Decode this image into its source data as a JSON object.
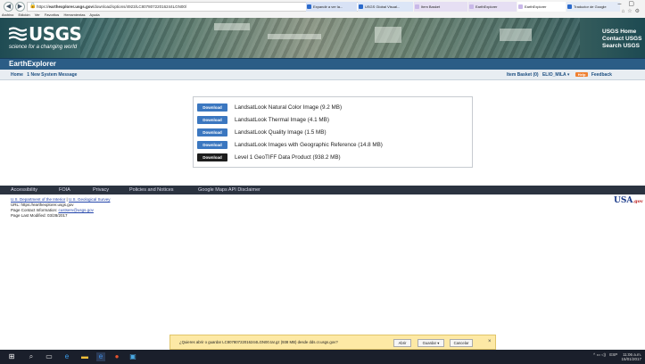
{
  "browser": {
    "url_host": "earthexplorer.usgs.gov",
    "url_prefix": "https://",
    "url_path": "/download/options/4923/LC80780722016244LGN00/",
    "tabs": [
      {
        "label": "Expandir a ver la...",
        "color": "#2b6acb"
      },
      {
        "label": "USGS Global Visual...",
        "color": "#2b6acb"
      },
      {
        "label": "Item Basket",
        "color": "#e8e0f6"
      },
      {
        "label": "EarthExplorer",
        "color": "#e8e0f6"
      },
      {
        "label": "EarthExplorer",
        "color": "#e8e0f6"
      },
      {
        "label": "Traductor de Google",
        "color": "#2b6acb"
      }
    ],
    "menu": [
      "Archivo",
      "Edición",
      "Ver",
      "Favoritos",
      "Herramientas",
      "Ayuda"
    ]
  },
  "header": {
    "logo_word": "USGS",
    "logo_tagline": "science for a changing world",
    "links": [
      "USGS Home",
      "Contact USGS",
      "Search USGS"
    ]
  },
  "app_title": "EarthExplorer",
  "subnav": {
    "home": "Home",
    "system_message": "1 New System Message",
    "item_basket": "Item Basket (0)",
    "user": "ELIO_MILA ▾",
    "help": "Help",
    "feedback": "Feedback"
  },
  "downloads": {
    "button_label": "Download",
    "items": [
      {
        "label": "LandsatLook Natural Color Image (9.2 MB)"
      },
      {
        "label": "LandsatLook Thermal Image (4.1 MB)"
      },
      {
        "label": "LandsatLook Quality Image (1.5 MB)"
      },
      {
        "label": "LandsatLook Images with Geographic Reference (14.8 MB)"
      },
      {
        "label": "Level 1 GeoTIFF Data Product (938.2 MB)"
      }
    ]
  },
  "footer": {
    "links": [
      "Accessibility",
      "FOIA",
      "Privacy",
      "Policies and Notices",
      "Google Maps API Disclaimer"
    ],
    "dept": "U.S. Department of the Interior",
    "survey": "U.S. Geological Survey",
    "url_line": "URL: https://earthexplorer.usgs.gov",
    "contact_prefix": "Page Contact Information:",
    "contact_email": "custserv@usgs.gov",
    "modified": "Page Last Modified: 03/28/2017",
    "usagov": "USA",
    "usagov_suffix": ".gov"
  },
  "notification": {
    "message": "¿Quieres abrir o guardar LC80780722016244LGN00.tar.gz (938 MB) desde dds.cr.usgs.gov?",
    "open": "Abrir",
    "save": "Guardar",
    "save_arrow": "▾",
    "cancel": "Cancelar"
  },
  "taskbar": {
    "time": "11:06 a.m.",
    "date": "15/01/2017",
    "lang": "ESP"
  }
}
